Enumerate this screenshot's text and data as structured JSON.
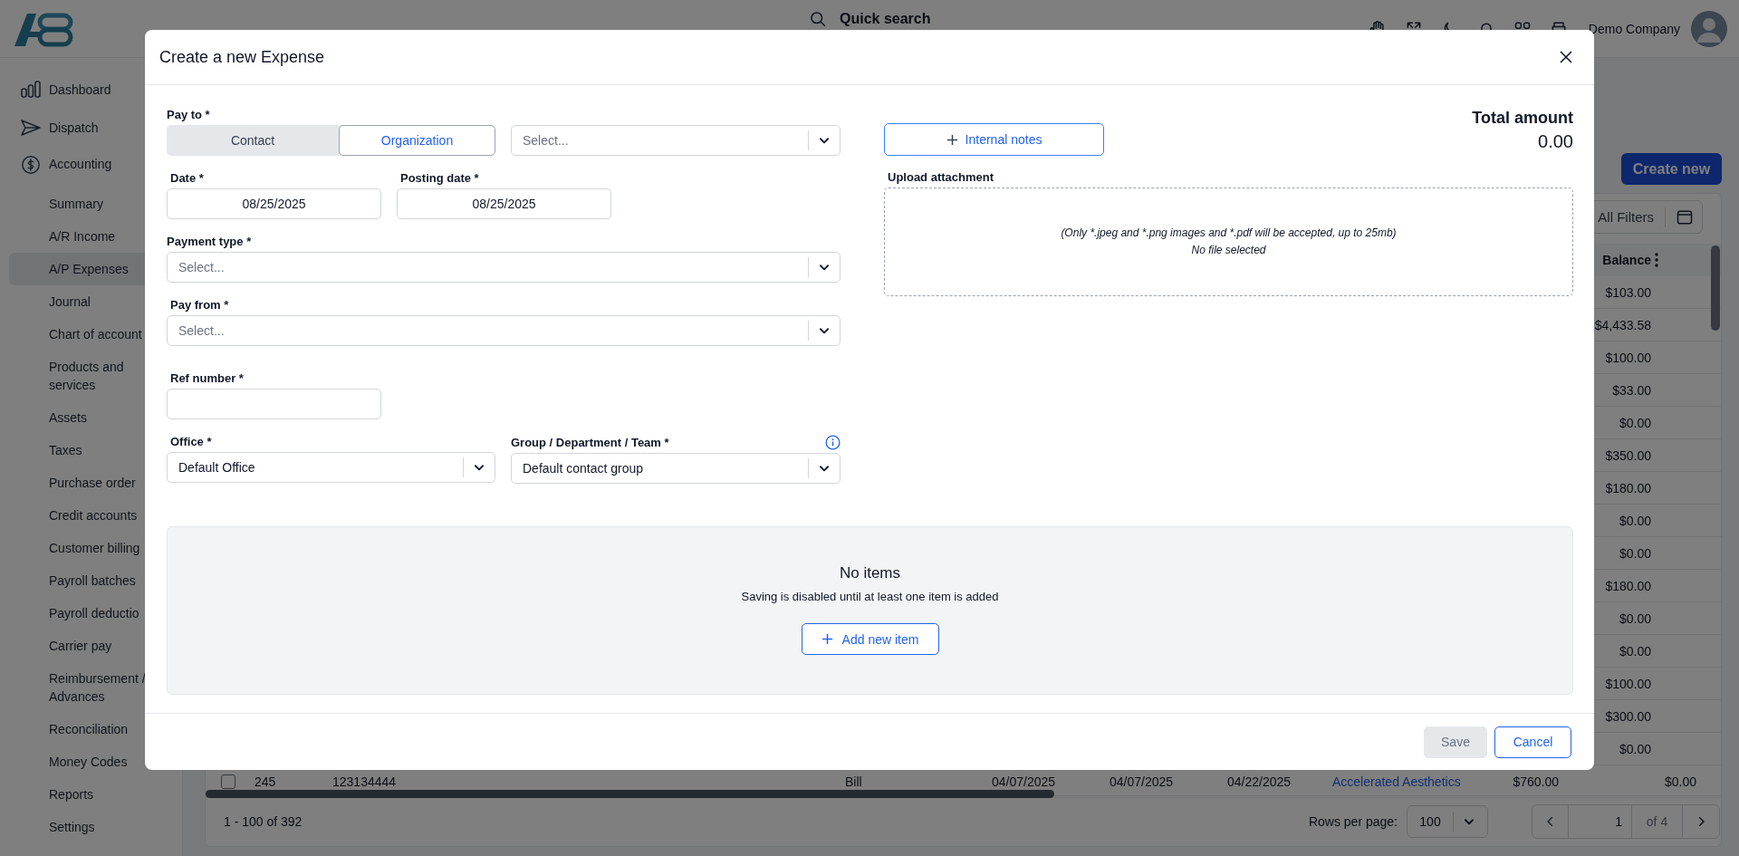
{
  "header": {
    "search_label": "Quick search",
    "company": "Demo Company"
  },
  "sidebar": {
    "items": [
      {
        "label": "Dashboard",
        "selected": false
      },
      {
        "label": "Dispatch",
        "selected": false
      },
      {
        "label": "Accounting",
        "selected": false,
        "children": [
          {
            "label": "Summary",
            "selected": false
          },
          {
            "label": "A/R Income",
            "selected": false
          },
          {
            "label": "A/P Expenses",
            "selected": true
          },
          {
            "label": "Journal",
            "selected": false
          },
          {
            "label": "Chart of account",
            "selected": false
          },
          {
            "label": "Products and services",
            "selected": false
          },
          {
            "label": "Assets",
            "selected": false
          },
          {
            "label": "Taxes",
            "selected": false
          },
          {
            "label": "Purchase order",
            "selected": false
          },
          {
            "label": "Credit accounts",
            "selected": false
          },
          {
            "label": "Customer billing",
            "selected": false
          },
          {
            "label": "Payroll batches",
            "selected": false
          },
          {
            "label": "Payroll deductio",
            "selected": false
          },
          {
            "label": "Carrier pay",
            "selected": false
          },
          {
            "label": "Reimbursement / Advances",
            "selected": false
          },
          {
            "label": "Reconciliation",
            "selected": false
          },
          {
            "label": "Money Codes",
            "selected": false
          },
          {
            "label": "Reports",
            "selected": false
          },
          {
            "label": "Settings",
            "selected": false
          }
        ]
      }
    ]
  },
  "page": {
    "create_button": "Create new",
    "filters_button": "All Filters",
    "table": {
      "balance_column": "Balance",
      "rows": [
        {
          "balance": "$103.00"
        },
        {
          "balance": "$4,433.58"
        },
        {
          "balance": "$100.00"
        },
        {
          "balance": "$33.00"
        },
        {
          "balance": "$0.00"
        },
        {
          "balance": "$350.00"
        },
        {
          "balance": "$180.00"
        },
        {
          "balance": "$0.00"
        },
        {
          "balance": "$0.00"
        },
        {
          "balance": "$180.00"
        },
        {
          "balance": "$0.00"
        },
        {
          "balance": "$0.00"
        },
        {
          "balance": "$100.00"
        },
        {
          "balance": "$300.00"
        },
        {
          "balance": "$0.00"
        },
        {
          "checked": false,
          "cells": [
            "245",
            "123134444",
            "Bill",
            "04/07/2025",
            "04/07/2025",
            "04/22/2025",
            "Accelerated Aesthetics",
            "$760.00"
          ],
          "balance": "$0.00"
        }
      ]
    },
    "pagination": {
      "range": "1 - 100 of 392",
      "rows_per_page_label": "Rows per page:",
      "rows_per_page": "100",
      "page": "1",
      "page_total": "of 4"
    }
  },
  "modal": {
    "title": "Create a new Expense",
    "pay_to": {
      "label": "Pay to *",
      "options": [
        {
          "label": "Contact",
          "selected": false
        },
        {
          "label": "Organization",
          "selected": true
        }
      ],
      "placeholder": "Select..."
    },
    "date": {
      "label": "Date *",
      "value": "08/25/2025"
    },
    "posting_date": {
      "label": "Posting date *",
      "value": "08/25/2025"
    },
    "payment_type": {
      "label": "Payment type *",
      "placeholder": "Select..."
    },
    "pay_from": {
      "label": "Pay from *",
      "placeholder": "Select..."
    },
    "ref_number": {
      "label": "Ref number *"
    },
    "office": {
      "label": "Office *",
      "value": "Default Office"
    },
    "group": {
      "label": "Group / Department / Team *",
      "value": "Default contact group"
    },
    "internal_notes_button": "Internal notes",
    "total": {
      "label": "Total amount",
      "value": "0.00"
    },
    "upload": {
      "label": "Upload attachment",
      "hint": "(Only *.jpeg and *.png images and *.pdf will be accepted, up to 25mb)",
      "status": "No file selected"
    },
    "items": {
      "title": "No items",
      "message": "Saving is disabled until at least one item is added",
      "add_button": "Add new item"
    },
    "buttons": [
      {
        "label": "Save",
        "disabled": true
      },
      {
        "label": "Cancel",
        "disabled": false
      }
    ]
  }
}
